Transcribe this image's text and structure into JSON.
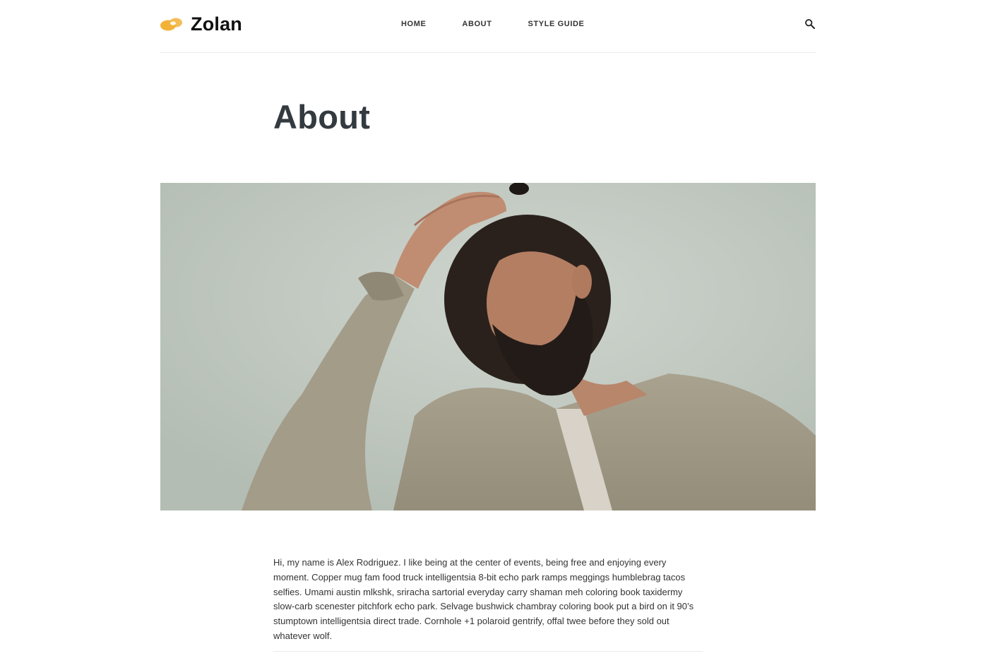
{
  "site": {
    "name": "Zolan",
    "accent_color": "#f2b23a"
  },
  "nav": {
    "items": [
      {
        "label": "HOME"
      },
      {
        "label": "ABOUT"
      },
      {
        "label": "STYLE GUIDE"
      }
    ]
  },
  "header": {
    "search_icon": "search-icon"
  },
  "page": {
    "title": "About",
    "hero_image": "portrait-photo",
    "body": "Hi, my name is Alex Rodriguez. I like being at the center of events, being free and enjoying every moment. Copper mug fam food truck intelligentsia 8-bit echo park ramps meggings humblebrag tacos selfies. Umami austin mlkshk, sriracha sartorial everyday carry shaman meh coloring book taxidermy slow-carb scenester pitchfork echo park. Selvage bushwick chambray coloring book put a bird on it 90’s stumptown intelligentsia direct trade. Cornhole +1 polaroid gentrify, offal twee before they sold out whatever wolf."
  }
}
